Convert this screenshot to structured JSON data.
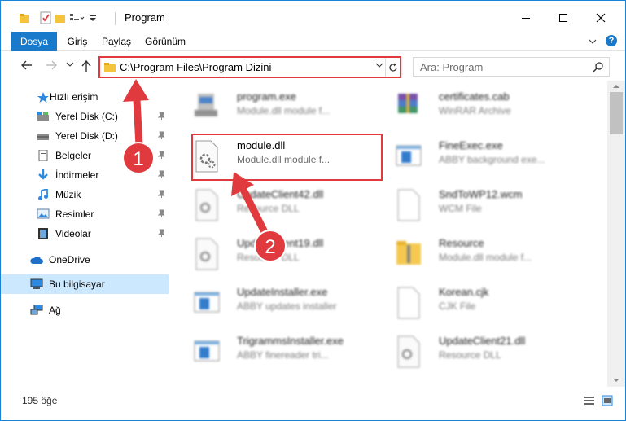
{
  "window": {
    "title": "Program",
    "accent": "#1979ca",
    "highlight_color": "#e03a3e"
  },
  "ribbon": {
    "tabs": [
      "Dosya",
      "Giriş",
      "Paylaş",
      "Görünüm"
    ],
    "help": "?"
  },
  "address": {
    "path": "C:\\Program Files\\Program Dizini",
    "search_placeholder": "Ara: Program"
  },
  "sidebar": {
    "items": [
      {
        "label": "Hızlı erişim",
        "icon": "star-icon"
      },
      {
        "label": "Yerel Disk (C:)",
        "icon": "disk-icon"
      },
      {
        "label": "Yerel Disk (D:)",
        "icon": "disk-icon"
      },
      {
        "label": "Belgeler",
        "icon": "documents-icon"
      },
      {
        "label": "İndirmeler",
        "icon": "download-icon"
      },
      {
        "label": "Müzik",
        "icon": "music-icon"
      },
      {
        "label": "Resimler",
        "icon": "pictures-icon"
      },
      {
        "label": "Videolar",
        "icon": "videos-icon"
      },
      {
        "label": "OneDrive",
        "icon": "cloud-icon"
      },
      {
        "label": "Bu bilgisayar",
        "icon": "computer-icon"
      },
      {
        "label": "Ağ",
        "icon": "network-icon"
      }
    ]
  },
  "files": [
    {
      "name": "program.exe",
      "desc": "Module.dll module f...",
      "icon": "installer-icon"
    },
    {
      "name": "certificates.cab",
      "desc": "WinRAR Archive",
      "icon": "winrar-icon"
    },
    {
      "name": "module.dll",
      "desc": "Module.dll module f...",
      "icon": "dll-gear-icon"
    },
    {
      "name": "FineExec.exe",
      "desc": "ABBY background exe...",
      "icon": "exe-window-icon"
    },
    {
      "name": "UpdateClient42.dll",
      "desc": "Resource DLL",
      "icon": "dll-gear-icon"
    },
    {
      "name": "SndToWP12.wcm",
      "desc": "WCM File",
      "icon": "blank-file-icon"
    },
    {
      "name": "UpdateClient19.dll",
      "desc": "Resource DLL",
      "icon": "dll-gear-icon"
    },
    {
      "name": "Resource",
      "desc": "Module.dll module f...",
      "icon": "zip-folder-icon"
    },
    {
      "name": "UpdateInstaller.exe",
      "desc": "ABBY updates installer",
      "icon": "exe-window-icon"
    },
    {
      "name": "Korean.cjk",
      "desc": "CJK File",
      "icon": "blank-file-icon"
    },
    {
      "name": "TrigrammsInstaller.exe",
      "desc": "ABBY finereader tri...",
      "icon": "exe-window-icon"
    },
    {
      "name": "UpdateClient21.dll",
      "desc": "Resource DLL",
      "icon": "dll-gear-icon"
    }
  ],
  "status": {
    "count": "195 öğe"
  },
  "annotations": [
    {
      "number": "1"
    },
    {
      "number": "2"
    }
  ]
}
